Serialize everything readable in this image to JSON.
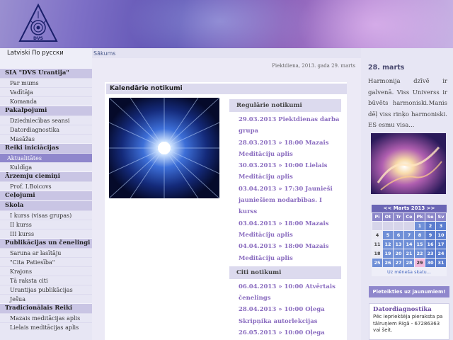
{
  "header": {
    "logo_text": "DVS"
  },
  "languages": [
    "Latviski",
    "По русски"
  ],
  "breadcrumb": "Sākums",
  "nav": [
    {
      "type": "sec",
      "label": "SIA \"DVS Urantija\""
    },
    {
      "type": "itm",
      "label": "Par mums"
    },
    {
      "type": "itm",
      "label": "Vadītāja"
    },
    {
      "type": "itm",
      "label": "Komanda"
    },
    {
      "type": "sec",
      "label": "Pakalpojumi"
    },
    {
      "type": "itm",
      "label": "Dziedniecības seansi"
    },
    {
      "type": "itm",
      "label": "Datordiagnostika"
    },
    {
      "type": "itm",
      "label": "Masāžas"
    },
    {
      "type": "sec",
      "label": "Reiki iniciācijas"
    },
    {
      "type": "active",
      "label": "Aktualitātes"
    },
    {
      "type": "itm",
      "label": "Kuldīga"
    },
    {
      "type": "sec",
      "label": "Ārzemju ciemiņi"
    },
    {
      "type": "itm",
      "label": "Prof. I.Boicovs"
    },
    {
      "type": "sec",
      "label": "Ceļojumi"
    },
    {
      "type": "sec",
      "label": "Skola"
    },
    {
      "type": "itm",
      "label": "I kurss (visas grupas)"
    },
    {
      "type": "itm",
      "label": "II kurss"
    },
    {
      "type": "itm",
      "label": "III kurss"
    },
    {
      "type": "sec",
      "label": "Publikācijas un čenelingi"
    },
    {
      "type": "itm",
      "label": "Saruna ar lasītāju"
    },
    {
      "type": "itm",
      "label": "\"Cita Patiesība\""
    },
    {
      "type": "itm",
      "label": "Krajons"
    },
    {
      "type": "itm",
      "label": "Tā raksta citi"
    },
    {
      "type": "itm",
      "label": "Urantijas publikācijas"
    },
    {
      "type": "itm",
      "label": "Ješua"
    },
    {
      "type": "sec",
      "label": "Tradicionālais Reiki"
    },
    {
      "type": "itm",
      "label": "Mazais meditācijas aplis"
    },
    {
      "type": "itm",
      "label": "Lielais meditācijas aplis"
    }
  ],
  "main": {
    "date_line": "Piektdiena, 2013. gada 29. marts",
    "panel_title": "Kalendārie notikumi",
    "regular_head": "Regulārie notikumi",
    "regular": [
      "29.03.2013 Piektdienas darba grupa",
      "28.03.2013 » 18:00 Mazais Meditāciju aplis",
      "30.03.2013 » 10:00 Lielais Meditāciju aplis",
      "03.04.2013 » 17:30 Jaunieši jauniešiem nodarbības. I kurss",
      "03.04.2013 » 18:00 Mazais Meditāciju aplis",
      "04.04.2013 » 18:00 Mazais Meditāciju aplis"
    ],
    "other_head": "Citi notikumi",
    "other": [
      "06.04.2013 » 10:00 Atvērtais čenelings",
      "28.04.2013 » 10:00 Oļega Skripņika autorlekcijas",
      "26.05.2013 » 10:00 Oļega Skripņika autorlekcijas"
    ]
  },
  "right": {
    "date": "28. marts",
    "quote": "Harmonija dzīvē ir galvenā. Viss Universs ir būvēts harmoniski.Manis dēļ viss rinķo harmoniski. ES esmu visa...",
    "calendar": {
      "header": "<< Marts 2013 >>",
      "weekdays": [
        "Pi",
        "Ot",
        "Tr",
        "Ce",
        "Pk",
        "Se",
        "Sv"
      ],
      "days": [
        "",
        "",
        "",
        "",
        "1",
        "2",
        "3",
        "4",
        "5",
        "6",
        "7",
        "8",
        "9",
        "10",
        "11",
        "12",
        "13",
        "14",
        "15",
        "16",
        "17",
        "18",
        "19",
        "20",
        "21",
        "22",
        "23",
        "24",
        "25",
        "26",
        "27",
        "28",
        "29",
        "30",
        "31"
      ],
      "today": "29",
      "footer": "Uz mēneša skatu..."
    },
    "subscribe": "Pieteikties uz jaunumiem!",
    "promo_title": "Datordiagnostika",
    "promo_text": "Pēc iepriekšēja pieraksta pa tālruņiem Rīgā - 67286363 vai šeit."
  }
}
